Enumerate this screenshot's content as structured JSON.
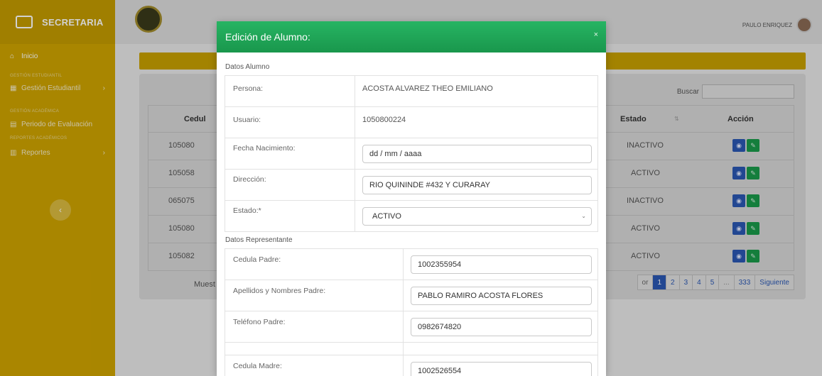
{
  "app": {
    "brand": "SECRETARIA",
    "user_name": "PAULO ENRIQUEZ"
  },
  "sidebar": {
    "home": "Inicio",
    "section1": "GESTIÓN ESTUDIANTIL",
    "item1": "Gestión Estudiantil",
    "section2": "GESTIÓN ACADÉMICA",
    "item2": "Periodo de Evaluación",
    "section3": "REPORTES ACADÉMICOS",
    "item3": "Reportes"
  },
  "table": {
    "search_label": "Buscar",
    "headers": {
      "cedula": "Cedul",
      "estado": "Estado",
      "accion": "Acción"
    },
    "rows": [
      {
        "cedula": "105080",
        "estado": "INACTIVO"
      },
      {
        "cedula": "105058",
        "estado": "ACTIVO"
      },
      {
        "cedula": "065075",
        "estado": "INACTIVO"
      },
      {
        "cedula": "105080",
        "estado": "ACTIVO"
      },
      {
        "cedula": "105082",
        "estado": "ACTIVO"
      }
    ],
    "footer_text": "Muest",
    "pager": {
      "prev": "or",
      "pages": [
        "1",
        "2",
        "3",
        "4",
        "5",
        "...",
        "333"
      ],
      "next": "Siguiente",
      "active": "1"
    }
  },
  "modal": {
    "title": "Edición de Alumno:",
    "close": "×",
    "section_alumno": "Datos Alumno",
    "persona_label": "Persona:",
    "persona_value": "ACOSTA ALVAREZ THEO EMILIANO",
    "usuario_label": "Usuario:",
    "usuario_value": "1050800224",
    "fecha_label": "Fecha Nacimiento:",
    "fecha_value": "dd / mm / aaaa",
    "direccion_label": "Dirección:",
    "direccion_value": "RIO QUININDE #432 Y CURARAY",
    "estado_label": "Estado:*",
    "estado_value": "ACTIVO",
    "section_representante": "Datos Representante",
    "cedula_padre_label": "Cedula Padre:",
    "cedula_padre_value": "1002355954",
    "nombres_padre_label": "Apellidos y Nombres Padre:",
    "nombres_padre_value": "PABLO RAMIRO  ACOSTA FLORES",
    "telefono_padre_label": "Teléfono Padre:",
    "telefono_padre_value": "0982674820",
    "cedula_madre_label": "Cedula Madre:",
    "cedula_madre_value": "1002526554"
  },
  "colors": {
    "sidebar": "#cfa400",
    "modal_header": "#1fa656",
    "primary_blue": "#2a57b3",
    "success_green": "#199a4a"
  }
}
